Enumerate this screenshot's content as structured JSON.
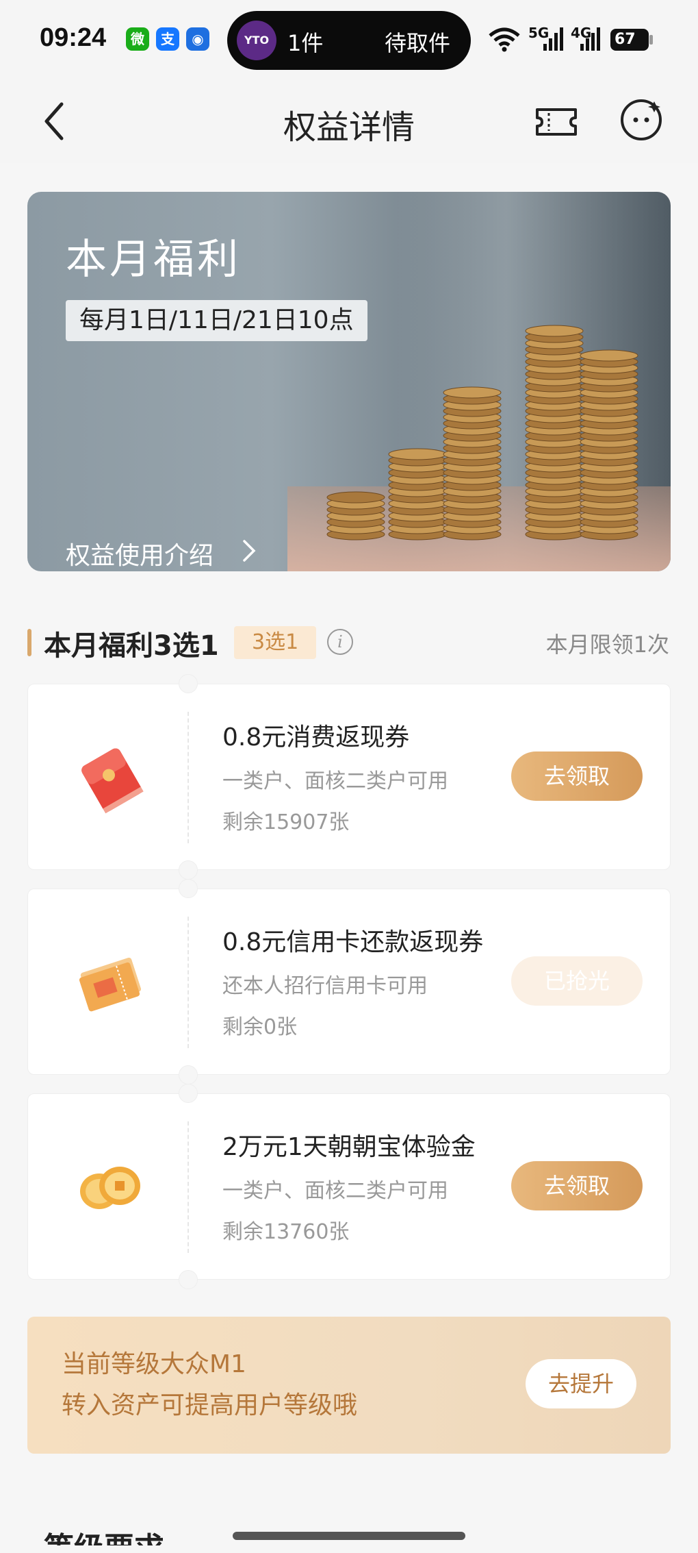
{
  "status_bar": {
    "time": "09:24",
    "apps": [
      {
        "icon": "wechat-icon",
        "label": "微",
        "color": "#1aad19"
      },
      {
        "icon": "alipay-icon",
        "label": "支",
        "color": "#1677ff"
      },
      {
        "icon": "bot-icon",
        "label": "◉",
        "color": "#1e6fe0"
      }
    ],
    "island": {
      "logo": "YTO",
      "count": "1件",
      "status": "待取件"
    },
    "network_5g": "5G",
    "network_4g": "4G",
    "battery": "67"
  },
  "nav": {
    "title": "权益详情"
  },
  "banner": {
    "title": "本月福利",
    "date": "每月1日/11日/21日10点",
    "link": "权益使用介绍"
  },
  "section": {
    "title": "本月福利3选1",
    "tag": "3选1",
    "info": "i",
    "limit": "本月限领1次"
  },
  "coupons": [
    {
      "name": "0.8元消费返现券",
      "desc": "一类户、面核二类户可用",
      "remaining": "剩余15907张",
      "button": "去领取",
      "available": true,
      "icon": "red-envelope-icon"
    },
    {
      "name": "0.8元信用卡还款返现券",
      "desc": "还本人招行信用卡可用",
      "remaining": "剩余0张",
      "button": "已抢光",
      "available": false,
      "icon": "coupon-ticket-icon"
    },
    {
      "name": "2万元1天朝朝宝体验金",
      "desc": "一类户、面核二类户可用",
      "remaining": "剩余13760张",
      "button": "去领取",
      "available": true,
      "icon": "gold-coin-icon"
    }
  ],
  "level": {
    "line1": "当前等级大众M1",
    "line2": "转入资产可提高用户等级哦",
    "button": "去提升"
  },
  "partial_section": {
    "title": "等级要求"
  }
}
